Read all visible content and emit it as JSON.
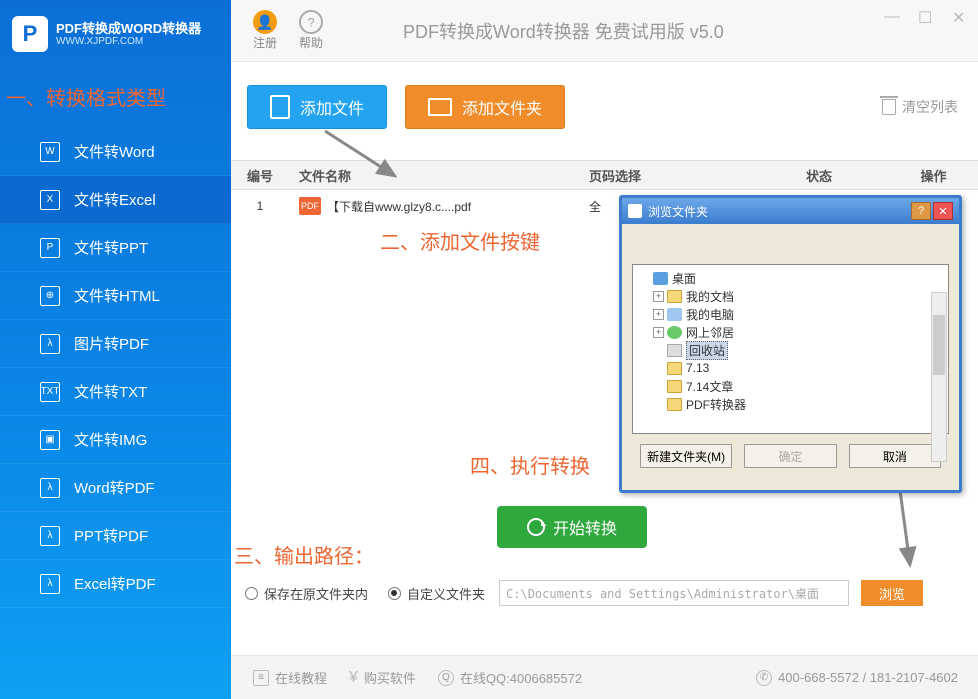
{
  "app": {
    "logo_title": "PDF转换成WORD转换器",
    "logo_url": "WWW.XJPDF.COM",
    "title": "PDF转换成Word转换器 免费试用版 v5.0"
  },
  "header": {
    "register": "注册",
    "help": "帮助"
  },
  "sidebar": {
    "items": [
      {
        "label": "文件转Word",
        "icon": "W"
      },
      {
        "label": "文件转Excel",
        "icon": "X"
      },
      {
        "label": "文件转PPT",
        "icon": "P"
      },
      {
        "label": "文件转HTML",
        "icon": "⊕"
      },
      {
        "label": "图片转PDF",
        "icon": "λ"
      },
      {
        "label": "文件转TXT",
        "icon": "TXT"
      },
      {
        "label": "文件转IMG",
        "icon": "▣"
      },
      {
        "label": "Word转PDF",
        "icon": "λ"
      },
      {
        "label": "PPT转PDF",
        "icon": "λ"
      },
      {
        "label": "Excel转PDF",
        "icon": "λ"
      }
    ],
    "active_index": 1
  },
  "actions": {
    "add_file": "添加文件",
    "add_folder": "添加文件夹",
    "clear_list": "清空列表"
  },
  "table": {
    "headers": {
      "num": "编号",
      "name": "文件名称",
      "pages": "页码选择",
      "status": "状态",
      "ops": "操作"
    },
    "rows": [
      {
        "num": "1",
        "name": "【下载自www.glzy8.c....pdf",
        "pages": "全"
      }
    ]
  },
  "annotations": {
    "a1": "一、转换格式类型",
    "a2": "二、添加文件按键",
    "a3": "三、输出路径：",
    "a4": "四、执行转换"
  },
  "start": "开始转换",
  "output": {
    "opt1": "保存在原文件夹内",
    "opt2": "自定义文件夹",
    "path": "C:\\Documents and Settings\\Administrator\\桌面",
    "browse": "浏览"
  },
  "footer": {
    "tutorial": "在线教程",
    "buy": "购买软件",
    "qq_label": "在线QQ:4006685572",
    "phone": "400-668-5572 / 181-2107-4602"
  },
  "dialog": {
    "title": "浏览文件夹",
    "tree": [
      {
        "label": "桌面",
        "icon": "desk",
        "level": 0,
        "exp": ""
      },
      {
        "label": "我的文档",
        "icon": "folder",
        "level": 1,
        "exp": "+"
      },
      {
        "label": "我的电脑",
        "icon": "comp",
        "level": 1,
        "exp": "+"
      },
      {
        "label": "网上邻居",
        "icon": "net",
        "level": 1,
        "exp": "+"
      },
      {
        "label": "回收站",
        "icon": "bin",
        "level": 1,
        "exp": "",
        "selected": true
      },
      {
        "label": "7.13",
        "icon": "folder",
        "level": 1,
        "exp": ""
      },
      {
        "label": "7.14文章",
        "icon": "folder",
        "level": 1,
        "exp": ""
      },
      {
        "label": "PDF转换器",
        "icon": "folder",
        "level": 1,
        "exp": ""
      }
    ],
    "new_folder": "新建文件夹(M)",
    "ok": "确定",
    "cancel": "取消"
  }
}
